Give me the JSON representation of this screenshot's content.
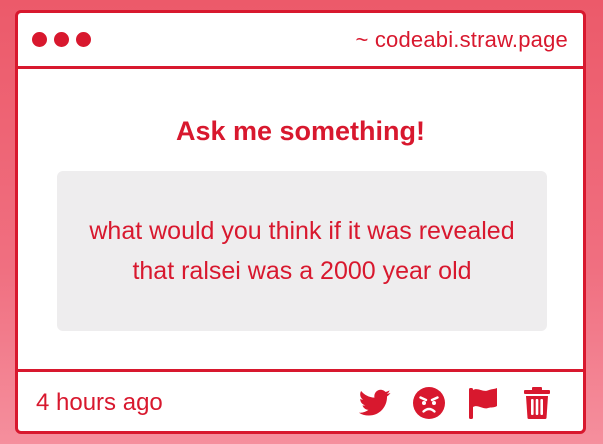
{
  "titlebar": {
    "url": "~ codeabi.straw.page"
  },
  "main": {
    "heading": "Ask me something!",
    "question": "what would you think if it was revealed that ralsei was a 2000 year old"
  },
  "footer": {
    "timestamp": "4 hours ago",
    "actions": [
      {
        "icon": "twitter-icon"
      },
      {
        "icon": "angry-face-icon"
      },
      {
        "icon": "flag-icon"
      },
      {
        "icon": "trash-icon"
      }
    ]
  },
  "colors": {
    "accent": "#d8182e",
    "card_bg": "#ffffff",
    "question_bg": "#eeedee",
    "page_bg": "#ec5a6a"
  }
}
